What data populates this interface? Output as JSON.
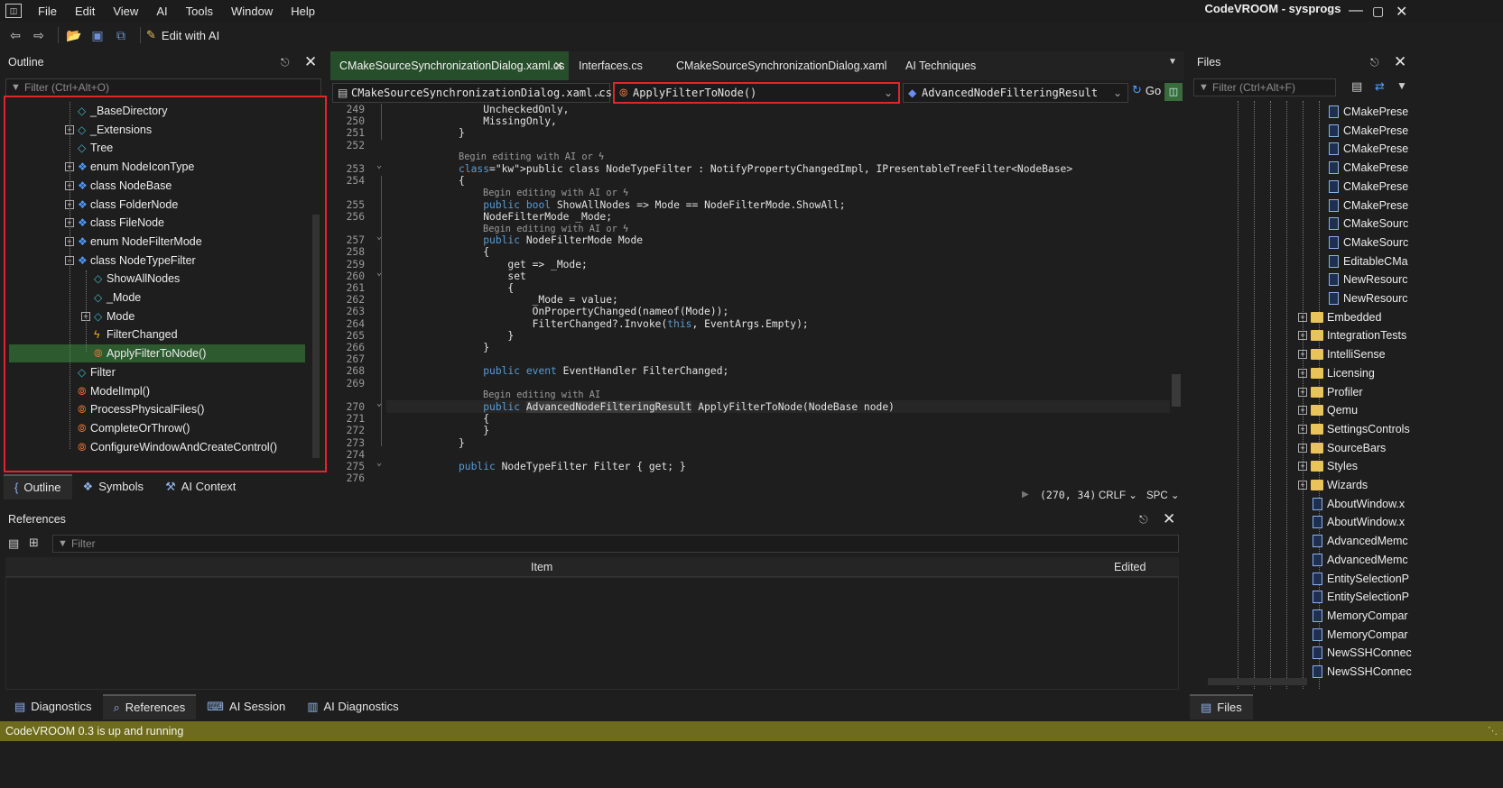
{
  "menu": {
    "items": [
      "File",
      "Edit",
      "View",
      "AI",
      "Tools",
      "Window",
      "Help"
    ],
    "app_icon": "app-logo-icon"
  },
  "window": {
    "title": "CodeVROOM - sysprogs"
  },
  "toolbar": {
    "edit_ai": "Edit with AI"
  },
  "outline": {
    "title": "Outline",
    "filter_placeholder": "Filter (Ctrl+Alt+O)",
    "items": [
      {
        "label": "_BaseDirectory",
        "icon": "field",
        "indent": 1,
        "expand": false
      },
      {
        "label": "_Extensions",
        "icon": "field",
        "indent": 1,
        "expand": true
      },
      {
        "label": "Tree",
        "icon": "field",
        "indent": 1,
        "expand": false
      },
      {
        "label": "enum NodeIconType",
        "icon": "class",
        "indent": 1,
        "expand": true
      },
      {
        "label": "class NodeBase",
        "icon": "class",
        "indent": 1,
        "expand": true
      },
      {
        "label": "class FolderNode",
        "icon": "class",
        "indent": 1,
        "expand": true
      },
      {
        "label": "class FileNode",
        "icon": "class",
        "indent": 1,
        "expand": true
      },
      {
        "label": "enum NodeFilterMode",
        "icon": "class",
        "indent": 1,
        "expand": true
      },
      {
        "label": "class NodeTypeFilter",
        "icon": "class",
        "indent": 1,
        "expand": true,
        "expanded": true
      },
      {
        "label": "ShowAllNodes",
        "icon": "field",
        "indent": 2,
        "expand": false
      },
      {
        "label": "_Mode",
        "icon": "field",
        "indent": 2,
        "expand": false
      },
      {
        "label": "Mode",
        "icon": "field",
        "indent": 2,
        "expand": true
      },
      {
        "label": "FilterChanged",
        "icon": "event",
        "indent": 2,
        "expand": false
      },
      {
        "label": "ApplyFilterToNode()",
        "icon": "method",
        "indent": 2,
        "expand": false,
        "selected": true
      },
      {
        "label": "Filter",
        "icon": "field",
        "indent": 1,
        "expand": false
      },
      {
        "label": "ModelImpl()",
        "icon": "method",
        "indent": 1,
        "expand": false
      },
      {
        "label": "ProcessPhysicalFiles()",
        "icon": "method",
        "indent": 1,
        "expand": false
      },
      {
        "label": "CompleteOrThrow()",
        "icon": "method",
        "indent": 1,
        "expand": false
      },
      {
        "label": "ConfigureWindowAndCreateControl()",
        "icon": "method",
        "indent": 1,
        "expand": false
      }
    ]
  },
  "left_tabs": [
    {
      "label": "Outline",
      "icon": "brace"
    },
    {
      "label": "Symbols",
      "icon": "symbols"
    },
    {
      "label": "AI Context",
      "icon": "wrench"
    }
  ],
  "editor": {
    "tabs": [
      {
        "label": "CMakeSourceSynchronizationDialog.xaml.cs",
        "active": true
      },
      {
        "label": "Interfaces.cs"
      },
      {
        "label": "CMakeSourceSynchronizationDialog.xaml"
      },
      {
        "label": "AI Techniques"
      }
    ],
    "nav_file": "CMakeSourceSynchronizationDialog.xaml.cs",
    "nav_member": "ApplyFilterToNode()",
    "nav_type": "AdvancedNodeFilteringResult",
    "go": "Go",
    "status": {
      "pos": "(270, 34)",
      "eol": "CRLF",
      "indent": "SPC"
    },
    "lines": [
      {
        "n": "249",
        "t": "    UncheckedOnly,"
      },
      {
        "n": "250",
        "t": "    MissingOnly,"
      },
      {
        "n": "251",
        "t": "}"
      },
      {
        "n": "252",
        "t": ""
      },
      {
        "ai": "Begin editing with AI or",
        "aiIndent": 0
      },
      {
        "n": "253",
        "t": "public class NodeTypeFilter : NotifyPropertyChangedImpl, IPresentableTreeFilter<NodeBase>",
        "kw": [
          "public",
          "class"
        ],
        "fold": true
      },
      {
        "n": "254",
        "t": "{"
      },
      {
        "ai": "Begin editing with AI or",
        "aiIndent": 1
      },
      {
        "n": "255",
        "t": "    public bool ShowAllNodes => Mode == NodeFilterMode.ShowAll;",
        "kw": [
          "public",
          "bool"
        ]
      },
      {
        "n": "256",
        "t": "    NodeFilterMode _Mode;"
      },
      {
        "ai": "Begin editing with AI or",
        "aiIndent": 1
      },
      {
        "n": "257",
        "t": "    public NodeFilterMode Mode",
        "kw": [
          "public"
        ],
        "fold": true
      },
      {
        "n": "258",
        "t": "    {"
      },
      {
        "n": "259",
        "t": "        get => _Mode;"
      },
      {
        "n": "260",
        "t": "        set",
        "fold": true
      },
      {
        "n": "261",
        "t": "        {"
      },
      {
        "n": "262",
        "t": "            _Mode = value;"
      },
      {
        "n": "263",
        "t": "            OnPropertyChanged(nameof(Mode));"
      },
      {
        "n": "264",
        "t": "            FilterChanged?.Invoke(this, EventArgs.Empty);",
        "kw": [
          "this"
        ]
      },
      {
        "n": "265",
        "t": "        }"
      },
      {
        "n": "266",
        "t": "    }"
      },
      {
        "n": "267",
        "t": ""
      },
      {
        "n": "268",
        "t": "    public event EventHandler FilterChanged;",
        "kw": [
          "public",
          "event"
        ]
      },
      {
        "n": "269",
        "t": ""
      },
      {
        "ai": "Begin editing with AI",
        "aiIndent": 1
      },
      {
        "n": "270",
        "t": "    public AdvancedNodeFilteringResult ApplyFilterToNode(NodeBase node)",
        "kw": [
          "public"
        ],
        "fold": true,
        "current": true
      },
      {
        "n": "271",
        "t": "    {"
      },
      {
        "n": "272",
        "t": "    }"
      },
      {
        "n": "273",
        "t": "}"
      },
      {
        "n": "274",
        "t": ""
      },
      {
        "n": "275",
        "t": "public NodeTypeFilter Filter { get; }",
        "kw": [
          "public"
        ],
        "fold": true
      },
      {
        "n": "276",
        "t": ""
      }
    ]
  },
  "references": {
    "title": "References",
    "filter_placeholder": "Filter",
    "col_item": "Item",
    "col_edited": "Edited"
  },
  "bottom_tabs": [
    {
      "label": "Diagnostics"
    },
    {
      "label": "References",
      "active": true
    },
    {
      "label": "AI Session"
    },
    {
      "label": "AI Diagnostics"
    }
  ],
  "files": {
    "title": "Files",
    "filter_placeholder": "Filter (Ctrl+Alt+F)",
    "items": [
      {
        "label": "CMakePrese",
        "type": "doc",
        "level": 3
      },
      {
        "label": "CMakePrese",
        "type": "doc",
        "level": 3
      },
      {
        "label": "CMakePrese",
        "type": "doc",
        "level": 3
      },
      {
        "label": "CMakePrese",
        "type": "doc",
        "level": 3
      },
      {
        "label": "CMakePrese",
        "type": "doc",
        "level": 3
      },
      {
        "label": "CMakePrese",
        "type": "doc",
        "level": 3
      },
      {
        "label": "CMakeSourc",
        "type": "doc",
        "level": 3
      },
      {
        "label": "CMakeSourc",
        "type": "doc",
        "level": 3
      },
      {
        "label": "EditableCMa",
        "type": "doc",
        "level": 3
      },
      {
        "label": "NewResourc",
        "type": "doc",
        "level": 3
      },
      {
        "label": "NewResourc",
        "type": "doc",
        "level": 3
      },
      {
        "label": "Embedded",
        "type": "folder",
        "level": 2
      },
      {
        "label": "IntegrationTests",
        "type": "folder",
        "level": 2
      },
      {
        "label": "IntelliSense",
        "type": "folder",
        "level": 2
      },
      {
        "label": "Licensing",
        "type": "folder",
        "level": 2
      },
      {
        "label": "Profiler",
        "type": "folder",
        "level": 2
      },
      {
        "label": "Qemu",
        "type": "folder",
        "level": 2
      },
      {
        "label": "SettingsControls",
        "type": "folder",
        "level": 2
      },
      {
        "label": "SourceBars",
        "type": "folder",
        "level": 2
      },
      {
        "label": "Styles",
        "type": "folder",
        "level": 2
      },
      {
        "label": "Wizards",
        "type": "folder",
        "level": 2
      },
      {
        "label": "AboutWindow.x",
        "type": "doc",
        "level": 2
      },
      {
        "label": "AboutWindow.x",
        "type": "doc",
        "level": 2
      },
      {
        "label": "AdvancedMemc",
        "type": "doc",
        "level": 2
      },
      {
        "label": "AdvancedMemc",
        "type": "doc",
        "level": 2
      },
      {
        "label": "EntitySelectionP",
        "type": "doc",
        "level": 2
      },
      {
        "label": "EntitySelectionP",
        "type": "doc",
        "level": 2
      },
      {
        "label": "MemoryCompar",
        "type": "doc",
        "level": 2
      },
      {
        "label": "MemoryCompar",
        "type": "doc",
        "level": 2
      },
      {
        "label": "NewSSHConnec",
        "type": "doc",
        "level": 2
      },
      {
        "label": "NewSSHConnec",
        "type": "doc",
        "level": 2
      }
    ],
    "tab": "Files"
  },
  "statusbar": {
    "text": "CodeVROOM 0.3 is up and running"
  },
  "colors": {
    "accent_green": "#2d5a2f",
    "highlight_red": "#e0262a",
    "status_bg": "#6e6b1e",
    "keyword": "#569cd6"
  }
}
